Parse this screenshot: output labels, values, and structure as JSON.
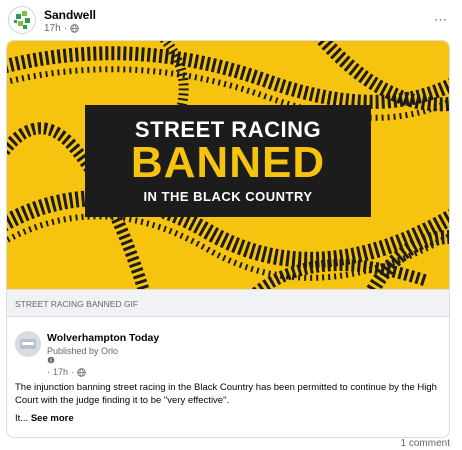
{
  "post": {
    "author": "Sandwell",
    "time": "17h",
    "separator": "·",
    "more_icon": "⋯"
  },
  "gif": {
    "line1": "STREET RACING",
    "line2": "BANNED",
    "line3": "IN THE BLACK COUNTRY",
    "caption": "STREET RACING BANNED GIF"
  },
  "shared": {
    "author": "Wolverhampton Today",
    "published_by": "Published by Orlo",
    "time": "17h",
    "separator": "·",
    "text": "The injunction banning street racing in the Black Country has been permitted to continue by the High Court with the judge finding it to be \"very effective\".",
    "ellipsis": "It...",
    "see_more": "See more"
  },
  "footer": {
    "comments": "1 comment"
  },
  "colors": {
    "yellow": "#f6c30f",
    "dark": "#1c1c1c",
    "muted": "#65676b"
  }
}
